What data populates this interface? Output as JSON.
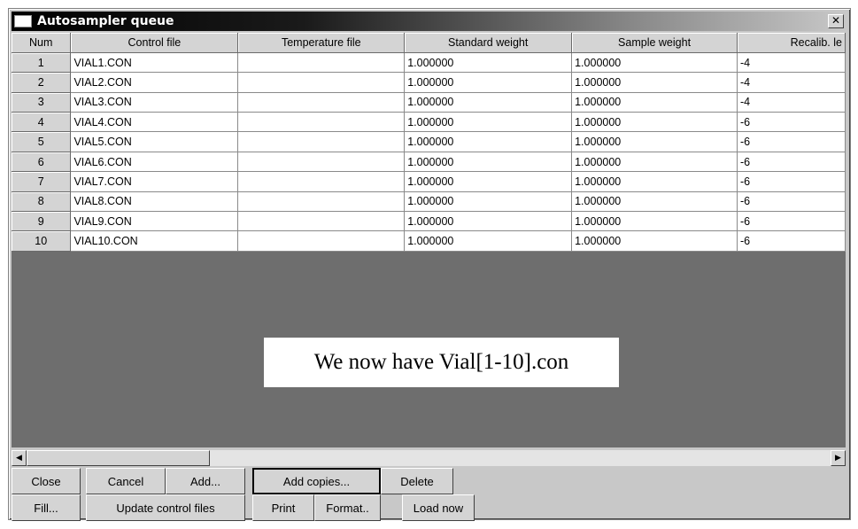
{
  "window": {
    "title": "Autosampler queue",
    "close_glyph": "✕"
  },
  "table": {
    "headers": [
      "Num",
      "Control file",
      "Temperature file",
      "Standard weight",
      "Sample weight",
      "Recalib. le"
    ],
    "rows": [
      {
        "num": "1",
        "control_file": "VIAL1.CON",
        "temperature_file": "",
        "standard_weight": "1.000000",
        "sample_weight": "1.000000",
        "recalib": "-4"
      },
      {
        "num": "2",
        "control_file": "VIAL2.CON",
        "temperature_file": "",
        "standard_weight": "1.000000",
        "sample_weight": "1.000000",
        "recalib": "-4"
      },
      {
        "num": "3",
        "control_file": "VIAL3.CON",
        "temperature_file": "",
        "standard_weight": "1.000000",
        "sample_weight": "1.000000",
        "recalib": "-4"
      },
      {
        "num": "4",
        "control_file": "VIAL4.CON",
        "temperature_file": "",
        "standard_weight": "1.000000",
        "sample_weight": "1.000000",
        "recalib": "-6"
      },
      {
        "num": "5",
        "control_file": "VIAL5.CON",
        "temperature_file": "",
        "standard_weight": "1.000000",
        "sample_weight": "1.000000",
        "recalib": "-6"
      },
      {
        "num": "6",
        "control_file": "VIAL6.CON",
        "temperature_file": "",
        "standard_weight": "1.000000",
        "sample_weight": "1.000000",
        "recalib": "-6"
      },
      {
        "num": "7",
        "control_file": "VIAL7.CON",
        "temperature_file": "",
        "standard_weight": "1.000000",
        "sample_weight": "1.000000",
        "recalib": "-6"
      },
      {
        "num": "8",
        "control_file": "VIAL8.CON",
        "temperature_file": "",
        "standard_weight": "1.000000",
        "sample_weight": "1.000000",
        "recalib": "-6"
      },
      {
        "num": "9",
        "control_file": "VIAL9.CON",
        "temperature_file": "",
        "standard_weight": "1.000000",
        "sample_weight": "1.000000",
        "recalib": "-6"
      },
      {
        "num": "10",
        "control_file": "VIAL10.CON",
        "temperature_file": "",
        "standard_weight": "1.000000",
        "sample_weight": "1.000000",
        "recalib": "-6"
      }
    ]
  },
  "annotation": "We now have Vial[1-10].con",
  "scrollbar": {
    "left_arrow": "◀",
    "right_arrow": "▶"
  },
  "buttons": {
    "close": "Close",
    "cancel": "Cancel",
    "add": "Add...",
    "add_copies": "Add copies...",
    "delete": "Delete",
    "fill": "Fill...",
    "update_control_files": "Update control files",
    "print": "Print",
    "format": "Format..",
    "load_now": "Load now"
  }
}
